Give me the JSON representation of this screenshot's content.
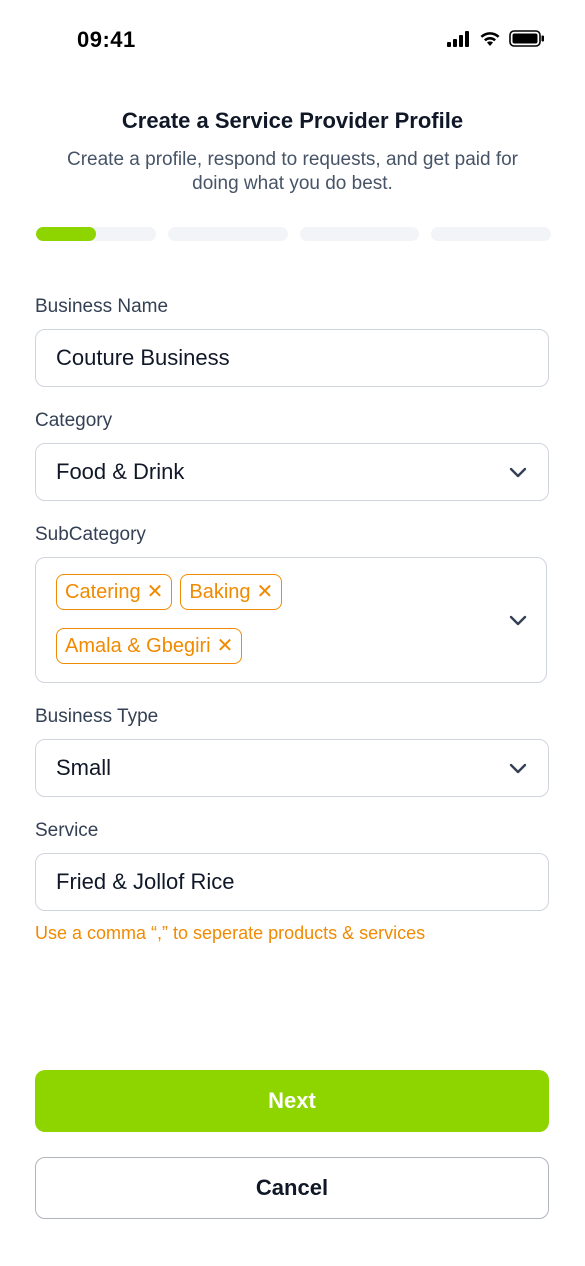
{
  "status_bar": {
    "time": "09:41",
    "icons": [
      "cellular-signal-icon",
      "wifi-icon",
      "battery-icon"
    ]
  },
  "header": {
    "title": "Create a Service Provider Profile",
    "subtitle": "Create a profile, respond to requests, and get paid for doing what you do best."
  },
  "progress": {
    "total_steps": 4,
    "current_step": 1,
    "step_fill_fraction": 0.5,
    "fill_color": "#8ed500",
    "track_color": "#f2f4f7"
  },
  "form": {
    "business_name": {
      "label": "Business Name",
      "value": "Couture Business"
    },
    "category": {
      "label": "Category",
      "value": "Food & Drink"
    },
    "subcategory": {
      "label": "SubCategory",
      "tags": [
        "Catering",
        "Baking",
        "Amala & Gbegiri"
      ],
      "remove_glyph": "✕"
    },
    "business_type": {
      "label": "Business Type",
      "value": "Small"
    },
    "service": {
      "label": "Service",
      "value": "Fried & Jollof Rice",
      "hint": "Use a comma “,” to seperate products & services"
    }
  },
  "actions": {
    "next_label": "Next",
    "cancel_label": "Cancel"
  },
  "colors": {
    "accent": "#8ed500",
    "warning": "#f08a00",
    "border": "#d0d5dd"
  }
}
